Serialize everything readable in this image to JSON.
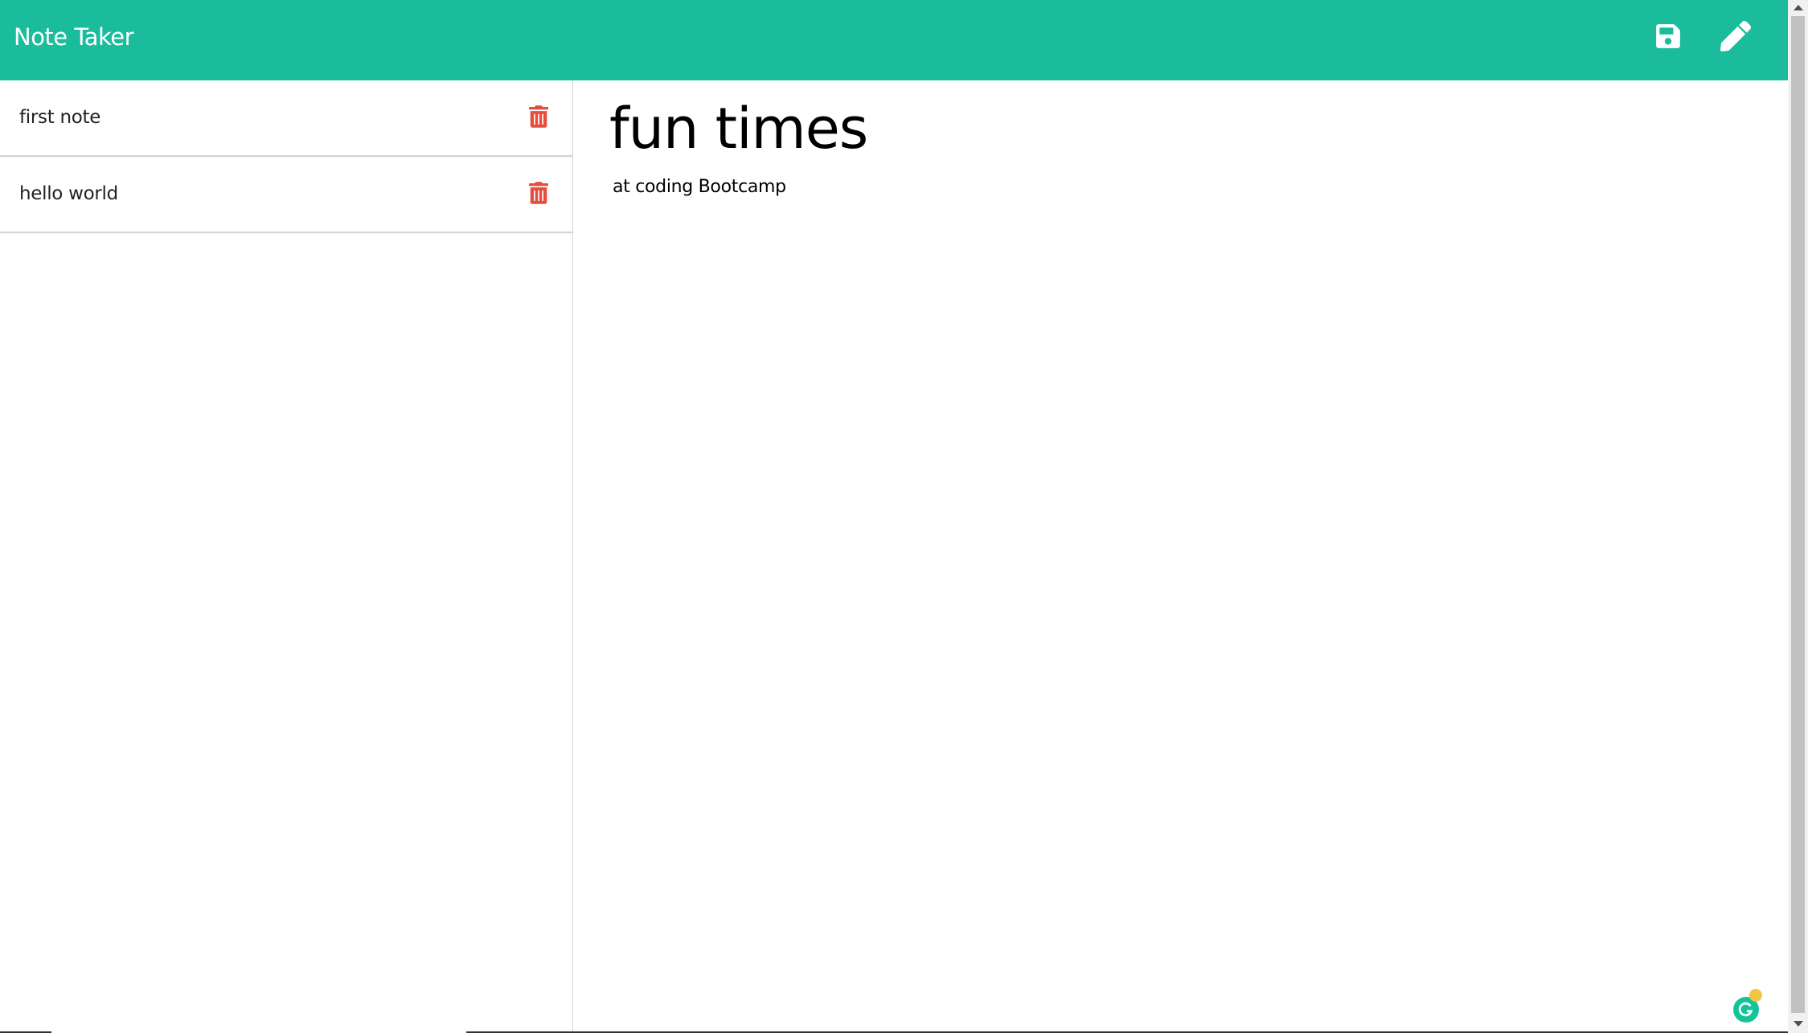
{
  "app": {
    "title": "Note Taker"
  },
  "header": {
    "brand": "Note Taker",
    "icons": {
      "save": "save-icon",
      "edit": "pencil-icon"
    }
  },
  "sidebar": {
    "notes": [
      {
        "title": "first note",
        "delete_icon": "trash-icon"
      },
      {
        "title": "hello world",
        "delete_icon": "trash-icon"
      }
    ]
  },
  "main": {
    "note_title": "fun times",
    "note_text": "at coding Bootcamp"
  },
  "colors": {
    "navbar": "#1abc9c",
    "delete": "#e74c3c",
    "text": "#000000",
    "grammarly": "#15c39a"
  }
}
